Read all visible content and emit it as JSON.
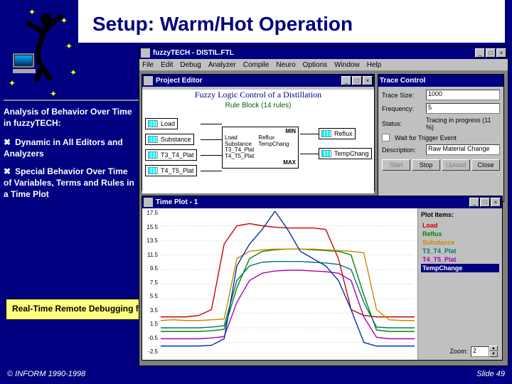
{
  "slide": {
    "title": "Setup: Warm/Hot Operation",
    "copyright": "© INFORM 1990-1998",
    "slide_number": "Slide 49"
  },
  "sidebar": {
    "heading": "Analysis of Behavior Over Time in fuzzyTECH:",
    "bullets": [
      "Dynamic in All Editors and Analyzers",
      "Special Behavior Over Time of Variables, Terms and Rules in a Time Plot"
    ],
    "callout": "Real-Time Remote Debugging for Systems Verification !"
  },
  "app": {
    "title": "fuzzyTECH - DISTIL.FTL",
    "menu": [
      "File",
      "Edit",
      "Debug",
      "Analyzer",
      "Compile",
      "Neuro",
      "Options",
      "Window",
      "Help"
    ]
  },
  "project_editor": {
    "title": "Project Editor",
    "heading": "Fuzzy Logic Control of a Distillation",
    "subheading": "Rule Block (14 rules)",
    "inputs": [
      "Load",
      "Substance",
      "T3_T4_Plat",
      "T4_T5_Plat"
    ],
    "rule_block": {
      "inputs_label": [
        "Load",
        "Substance",
        "T3_T4_Plat",
        "T4_T5_Plat"
      ],
      "top": "MIN",
      "outputs_label": [
        "Reflux",
        "TempChang"
      ],
      "bottom": "MAX"
    },
    "outputs": [
      "Reflux",
      "TempChang"
    ]
  },
  "trace_control": {
    "title": "Trace Control",
    "labels": {
      "trace_size": "Trace Size:",
      "frequency": "Frequency:",
      "status": "Status:",
      "wait": "Wait for Trigger Event",
      "description": "Description:"
    },
    "values": {
      "trace_size": "1000",
      "frequency": "5",
      "status": "Tracing in progress (11 %)",
      "description": "Raw Material Change"
    },
    "buttons": {
      "start": "Start",
      "stop": "Stop",
      "upload": "Upload",
      "close": "Close"
    }
  },
  "time_plot": {
    "title": "Time Plot - 1",
    "y_ticks": [
      "17.5",
      "15.5",
      "13.5",
      "11.5",
      "9.5",
      "7.5",
      "5.5",
      "3.5",
      "1.5",
      "-0.5",
      "-2.5"
    ],
    "items_label": "Plot Items:",
    "items": [
      {
        "label": "Load",
        "color": "#cc0000",
        "selected": false
      },
      {
        "label": "Reflux",
        "color": "#008800",
        "selected": false
      },
      {
        "label": "Substance",
        "color": "#cc8800",
        "selected": false
      },
      {
        "label": "T3_T4_Plat",
        "color": "#007777",
        "selected": false
      },
      {
        "label": "T4_T5_Plat",
        "color": "#aa00aa",
        "selected": false
      },
      {
        "label": "TempChange",
        "color": "#ffffff",
        "selected": true
      }
    ],
    "zoom_label": "Zoom:",
    "zoom_value": "2"
  },
  "chart_data": {
    "type": "line",
    "title": "Time Plot - 1",
    "xlabel": "",
    "ylabel": "",
    "ylim": [
      -2.5,
      17.5
    ],
    "x": [
      0,
      10,
      20,
      30,
      40,
      50,
      60,
      70,
      80,
      90,
      100,
      110,
      120,
      130,
      140,
      150,
      160,
      170,
      180,
      190,
      200
    ],
    "series": [
      {
        "name": "Load",
        "color": "#cc0000",
        "values": [
          3,
          3,
          3,
          3.2,
          4,
          13,
          15.5,
          15.8,
          15.5,
          15.3,
          15.2,
          15.2,
          15.2,
          15.0,
          11,
          4,
          3.2,
          3,
          3,
          3,
          3
        ]
      },
      {
        "name": "Reflux",
        "color": "#008800",
        "values": [
          1,
          1,
          1,
          1,
          1.1,
          1.3,
          7,
          11,
          12,
          12.2,
          12.3,
          12.3,
          12.2,
          12.1,
          12.0,
          11.5,
          6,
          1.2,
          1,
          1,
          1
        ]
      },
      {
        "name": "Substance",
        "color": "#cc8800",
        "values": [
          2.5,
          2.6,
          2.5,
          2.5,
          2.6,
          2.7,
          11,
          12,
          12.2,
          12.3,
          12.3,
          12.3,
          12.3,
          12.2,
          12.1,
          12.0,
          11.8,
          4,
          2.6,
          2.5,
          2.5
        ]
      },
      {
        "name": "T3_T4_Plat",
        "color": "#007777",
        "values": [
          1.5,
          1.5,
          1.5,
          1.5,
          1.6,
          1.8,
          8,
          10,
          10.5,
          10.6,
          10.6,
          10.6,
          10.5,
          10.4,
          10.2,
          9.5,
          5,
          1.6,
          1.5,
          1.5,
          1.5
        ]
      },
      {
        "name": "T4_T5_Plat",
        "color": "#aa00aa",
        "values": [
          0,
          0,
          0,
          0,
          0.1,
          0.3,
          5,
          8,
          9,
          9.3,
          9.4,
          9.4,
          9.3,
          9.2,
          9.0,
          8,
          3,
          0.2,
          0,
          0,
          0
        ]
      },
      {
        "name": "TempChange",
        "color": "#0030aa",
        "values": [
          -1,
          -1,
          -1,
          -1,
          -0.9,
          0,
          10,
          13,
          15,
          17.5,
          15,
          12,
          11,
          10,
          8,
          4,
          -0.5,
          -1,
          -1,
          -1,
          -1
        ]
      }
    ]
  }
}
